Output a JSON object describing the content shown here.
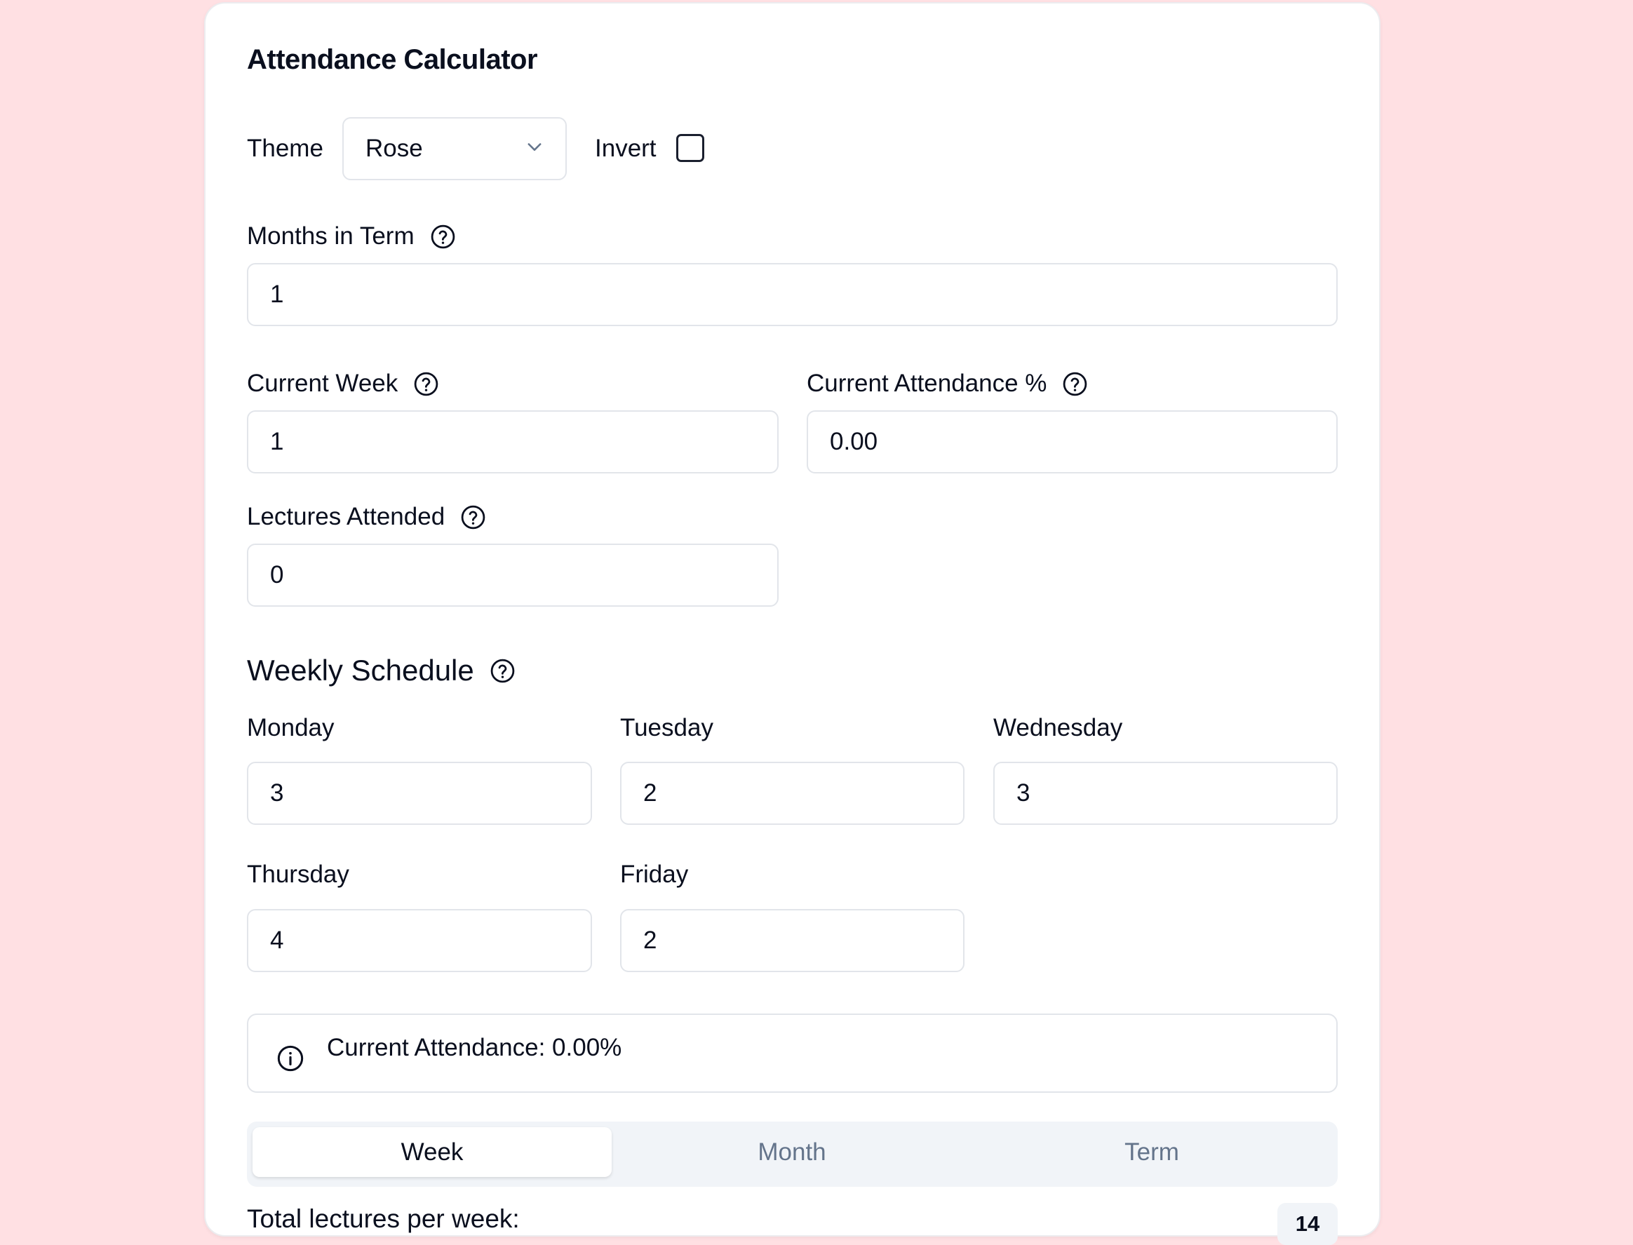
{
  "app": {
    "title": "Attendance Calculator"
  },
  "theme": {
    "label": "Theme",
    "selected": "Rose"
  },
  "invert": {
    "label": "Invert",
    "checked": false
  },
  "months_in_term": {
    "label": "Months in Term",
    "value": "1"
  },
  "current_week": {
    "label": "Current Week",
    "value": "1"
  },
  "current_attendance": {
    "label": "Current Attendance %",
    "value": "0.00"
  },
  "lectures_attended": {
    "label": "Lectures Attended",
    "value": "0"
  },
  "weekly_schedule": {
    "title": "Weekly Schedule",
    "days": [
      {
        "label": "Monday",
        "value": "3"
      },
      {
        "label": "Tuesday",
        "value": "2"
      },
      {
        "label": "Wednesday",
        "value": "3"
      },
      {
        "label": "Thursday",
        "value": "4"
      },
      {
        "label": "Friday",
        "value": "2"
      }
    ]
  },
  "alert": {
    "text": "Current Attendance: 0.00%",
    "icon": "info-icon"
  },
  "tabs": [
    {
      "label": "Week",
      "active": true
    },
    {
      "label": "Month",
      "active": false
    },
    {
      "label": "Term",
      "active": false
    }
  ],
  "summary": {
    "label": "Total lectures per week:",
    "value": "14"
  },
  "colors": {
    "background": "#ffe0e3",
    "card": "#ffffff",
    "muted_tab_text": "#64748b",
    "tab_bar": "#f1f4f8"
  }
}
